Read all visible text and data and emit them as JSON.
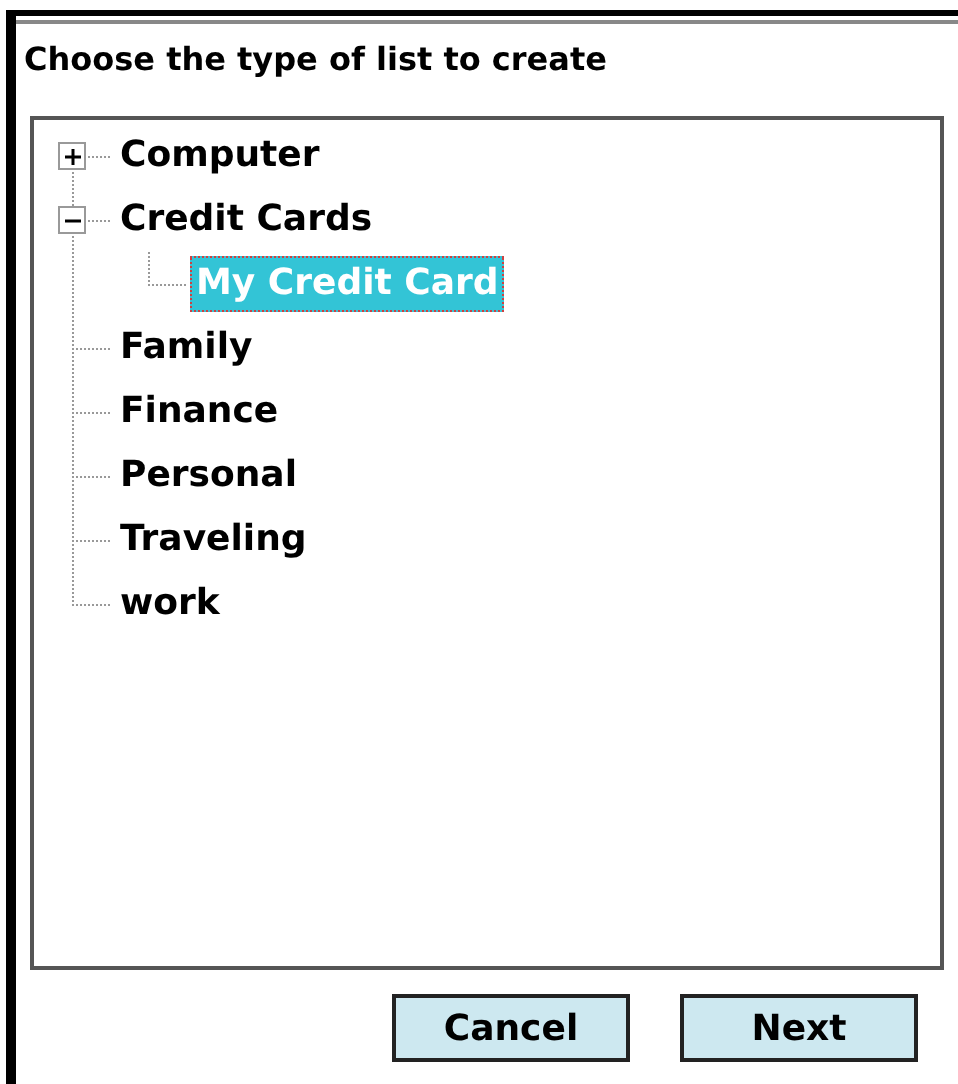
{
  "header": "Choose the type of list to create",
  "tree": {
    "items": [
      {
        "label": "Computer",
        "expanded": false,
        "selected": false
      },
      {
        "label": "Credit Cards",
        "expanded": true,
        "selected": false,
        "children": [
          {
            "label": "My Credit Card",
            "selected": true
          }
        ]
      },
      {
        "label": "Family",
        "selected": false
      },
      {
        "label": "Finance",
        "selected": false
      },
      {
        "label": "Personal",
        "selected": false
      },
      {
        "label": "Traveling",
        "selected": false
      },
      {
        "label": "work",
        "selected": false
      }
    ]
  },
  "buttons": [
    "Cancel",
    "Next"
  ]
}
